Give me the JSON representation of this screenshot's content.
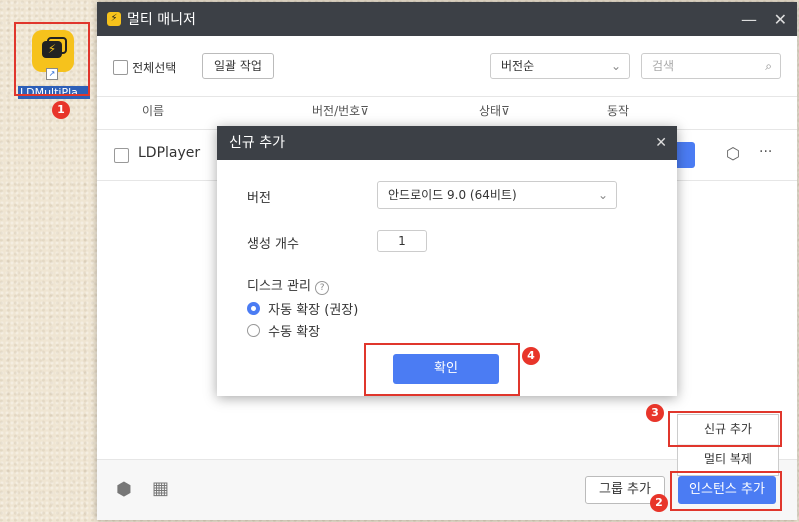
{
  "desktop": {
    "icon_label": "LDMultiPla..."
  },
  "window": {
    "title": "멀티 매니저",
    "minimize": "—",
    "close": "✕",
    "select_all": "전체선택",
    "batch_button": "일괄 작업",
    "sort_select": "버전순",
    "search_placeholder": "검색",
    "columns": [
      "이름",
      "버전/번호",
      "상태",
      "동작"
    ],
    "instance_name": "LDPlayer",
    "more": "···",
    "group_add": "그룹 추가",
    "add_instance": "인스턴스 추가"
  },
  "dialog": {
    "title": "신규 추가",
    "close": "✕",
    "version_label": "버전",
    "version_value": "안드로이드 9.0 (64비트)",
    "count_label": "생성 개수",
    "count_value": "1",
    "disk_label": "디스크 관리",
    "help": "?",
    "radio_auto": "자동 확장 (권장)",
    "radio_manual": "수동 확장",
    "confirm": "확인"
  },
  "menu": {
    "new_add": "신규 추가",
    "multi_copy": "멀티 복제"
  },
  "badges": [
    "1",
    "2",
    "3",
    "4"
  ],
  "colors": {
    "accent": "#4b7cf3",
    "titlebar": "#3c4046",
    "highlight": "#e0362c",
    "app_yellow": "#f6c21c"
  }
}
